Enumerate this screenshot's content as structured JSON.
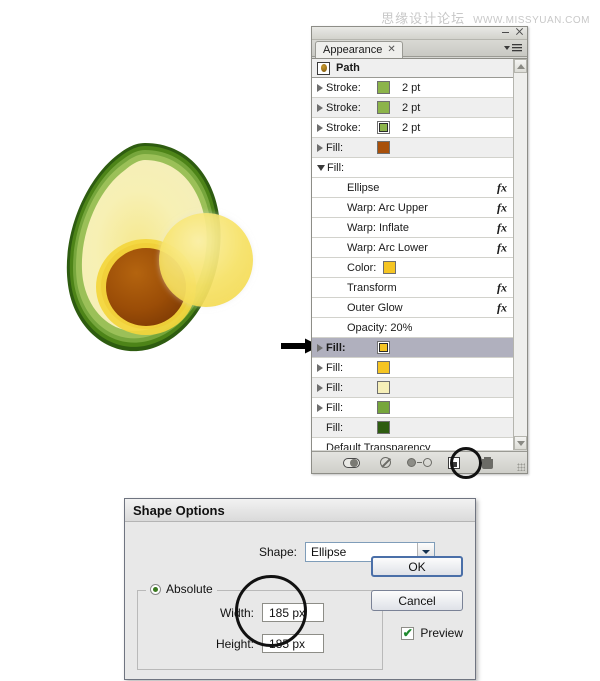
{
  "watermark": {
    "cn": "思缘设计论坛",
    "url": "WWW.MISSYUAN.COM"
  },
  "artwork": {
    "name": "avocado-half-illustration",
    "colors": {
      "skin_dark": "#3f7019",
      "skin_mid": "#6ea032",
      "skin_light": "#9dc45a",
      "flesh_outer": "#f2eeb0",
      "flesh_mid": "#f7efae",
      "flesh_inner": "#f6e27a",
      "ring_gold": "#f4d33a",
      "pit_dark": "#8a3f06",
      "pit_light": "#c9761a",
      "overlay_yellow": "#f7e05a"
    }
  },
  "panel": {
    "tab_label": "Appearance",
    "tab_close": "✕",
    "target_label": "Path",
    "rows": [
      {
        "type": "stroke",
        "disclosure": "right",
        "label": "Stroke:",
        "swatch": "#8cb44a",
        "value": "2 pt",
        "fx": false,
        "indent": 0,
        "selected": false,
        "ringed": false
      },
      {
        "type": "stroke",
        "disclosure": "right",
        "label": "Stroke:",
        "swatch": "#8cb44a",
        "value": "2 pt",
        "fx": false,
        "indent": 0,
        "selected": false,
        "ringed": false
      },
      {
        "type": "stroke",
        "disclosure": "right",
        "label": "Stroke:",
        "swatch": "#8cb44a",
        "value": "2 pt",
        "fx": false,
        "indent": 0,
        "selected": false,
        "ringed": true
      },
      {
        "type": "fill",
        "disclosure": "right",
        "label": "Fill:",
        "swatch": "#a8500a",
        "value": "",
        "fx": false,
        "indent": 0,
        "selected": false,
        "ringed": false
      },
      {
        "type": "fill",
        "disclosure": "down",
        "label": "Fill:",
        "swatch": "",
        "value": "",
        "fx": false,
        "indent": 0,
        "selected": false,
        "ringed": false
      },
      {
        "type": "effect",
        "disclosure": "none",
        "label": "Ellipse",
        "swatch": "",
        "value": "",
        "fx": true,
        "indent": 1,
        "selected": false,
        "ringed": false
      },
      {
        "type": "effect",
        "disclosure": "none",
        "label": "Warp: Arc Upper",
        "swatch": "",
        "value": "",
        "fx": true,
        "indent": 1,
        "selected": false,
        "ringed": false
      },
      {
        "type": "effect",
        "disclosure": "none",
        "label": "Warp: Inflate",
        "swatch": "",
        "value": "",
        "fx": true,
        "indent": 1,
        "selected": false,
        "ringed": false
      },
      {
        "type": "effect",
        "disclosure": "none",
        "label": "Warp: Arc Lower",
        "swatch": "",
        "value": "",
        "fx": true,
        "indent": 1,
        "selected": false,
        "ringed": false
      },
      {
        "type": "color",
        "disclosure": "none",
        "label": "Color:",
        "swatch": "#f5c523",
        "value": "",
        "fx": false,
        "indent": 1,
        "selected": false,
        "ringed": false
      },
      {
        "type": "effect",
        "disclosure": "none",
        "label": "Transform",
        "swatch": "",
        "value": "",
        "fx": true,
        "indent": 1,
        "selected": false,
        "ringed": false
      },
      {
        "type": "effect",
        "disclosure": "none",
        "label": "Outer Glow",
        "swatch": "",
        "value": "",
        "fx": true,
        "indent": 1,
        "selected": false,
        "ringed": false
      },
      {
        "type": "opacity",
        "disclosure": "none",
        "label": "Opacity: 20%",
        "swatch": "",
        "value": "",
        "fx": false,
        "indent": 1,
        "selected": false,
        "ringed": false
      },
      {
        "type": "fill",
        "disclosure": "right",
        "label": "Fill:",
        "swatch": "#f5c523",
        "value": "",
        "fx": false,
        "indent": 0,
        "selected": true,
        "ringed": true
      },
      {
        "type": "fill",
        "disclosure": "right",
        "label": "Fill:",
        "swatch": "#f5c523",
        "value": "",
        "fx": false,
        "indent": 0,
        "selected": false,
        "ringed": false
      },
      {
        "type": "fill",
        "disclosure": "right",
        "label": "Fill:",
        "swatch": "#f6efb8",
        "value": "",
        "fx": false,
        "indent": 0,
        "selected": false,
        "ringed": false
      },
      {
        "type": "fill",
        "disclosure": "right",
        "label": "Fill:",
        "swatch": "#76a63c",
        "value": "",
        "fx": false,
        "indent": 0,
        "selected": false,
        "ringed": false
      },
      {
        "type": "fill",
        "disclosure": "none",
        "label": "Fill:",
        "swatch": "#2e5c10",
        "value": "",
        "fx": false,
        "indent": 0,
        "selected": false,
        "ringed": false
      },
      {
        "type": "transparency",
        "disclosure": "none",
        "label": "Default Transparency",
        "swatch": "",
        "value": "",
        "fx": false,
        "indent": 0,
        "selected": false,
        "ringed": false
      }
    ],
    "footer_icons": [
      "visibility-toggle-icon",
      "clear-appearance-icon",
      "reduce-to-basic-appearance-icon",
      "duplicate-selected-item-icon",
      "delete-selected-item-icon"
    ],
    "fx_glyph": "fx"
  },
  "dialog": {
    "title": "Shape Options",
    "shape_label": "Shape:",
    "shape_value": "Ellipse",
    "absolute_label": "Absolute",
    "width_label": "Width:",
    "width_value": "185 px",
    "height_label": "Height:",
    "height_value": "185 px",
    "ok_label": "OK",
    "cancel_label": "Cancel",
    "preview_label": "Preview",
    "preview_checked": "✔"
  }
}
